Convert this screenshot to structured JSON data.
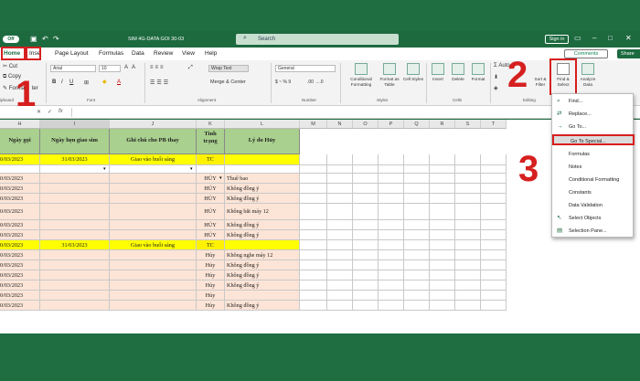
{
  "titlebar": {
    "autosave_toggle": "Off",
    "doc_name": "SIM 4G-DATA GOI 30-03",
    "search_placeholder": "Search",
    "signin": "Sign in"
  },
  "menu_tabs": [
    "Home",
    "Inse",
    "Page Layout",
    "Formulas",
    "Data",
    "Review",
    "View",
    "Help"
  ],
  "comments_label": "Comments",
  "share_label": "Share",
  "ribbon": {
    "clipboard": {
      "cut": "Cut",
      "copy": "Copy",
      "format": "Format",
      "painter_suffix": "ter",
      "label": "ipboard"
    },
    "font": {
      "name": "Arial",
      "size": "10",
      "label": "Font"
    },
    "alignment": {
      "wrap": "Wrap Text",
      "merge": "Merge & Center",
      "label": "Alignment"
    },
    "number": {
      "format": "General",
      "symbols": "$ ~ % 9",
      "decimals": ".00 →.0",
      "label": "Number"
    },
    "styles": {
      "conditional": "Conditional Formatting",
      "format_table": "Format as Table",
      "cell_styles": "Cell Styles",
      "label": "Styles"
    },
    "cells": {
      "insert": "Insert",
      "delete": "Delete",
      "format": "Format",
      "label": "Cells"
    },
    "editing": {
      "autosum": "Auto",
      "sort": "Sort & Filter",
      "find": "Find & Select",
      "analyze": "Analyze Data",
      "label": "Editing"
    }
  },
  "formula_bar": {
    "fx": "fx"
  },
  "columns": [
    "H",
    "I",
    "J",
    "K",
    "L",
    "M",
    "N",
    "O",
    "P",
    "Q",
    "R",
    "S",
    "T"
  ],
  "table_headers": {
    "h": "Ngày gọi",
    "i": "Ngày hẹn giao sim",
    "j": "Ghi chú cho PB thay",
    "k": "Tình trạng",
    "l": "Lý do Hủy"
  },
  "rows": [
    {
      "h": "0/03/2023",
      "i": "31/03/2023",
      "j": "Giao vào buổi sáng",
      "k": "TC",
      "l": "",
      "style": "yellow"
    },
    {
      "h": "",
      "i": "",
      "j": "",
      "k": "",
      "l": "",
      "style": "white"
    },
    {
      "h": "0/03/2023",
      "i": "",
      "j": "",
      "k": "HỦY",
      "l": "Thuê bao",
      "style": "pink"
    },
    {
      "h": "0/03/2023",
      "i": "",
      "j": "",
      "k": "HỦY",
      "l": "Không đồng ý",
      "style": "pink"
    },
    {
      "h": "0/03/2023",
      "i": "",
      "j": "",
      "k": "HỦY",
      "l": "Không đồng ý",
      "style": "pink"
    },
    {
      "h": "0/03/2023",
      "i": "",
      "j": "",
      "k": "HỦY",
      "l": "Không bắt máy 12",
      "style": "pink"
    },
    {
      "h": "0/03/2023",
      "i": "",
      "j": "",
      "k": "HỦY",
      "l": "Không đồng ý",
      "style": "pink"
    },
    {
      "h": "0/03/2023",
      "i": "",
      "j": "",
      "k": "HỦY",
      "l": "Không đồng ý",
      "style": "pink"
    },
    {
      "h": "0/03/2023",
      "i": "31/03/2023",
      "j": "Giao vào buổi sáng",
      "k": "TC",
      "l": "",
      "style": "yellow"
    },
    {
      "h": "0/03/2023",
      "i": "",
      "j": "",
      "k": "Hủy",
      "l": "Không nghe máy 12",
      "style": "pink"
    },
    {
      "h": "0/03/2023",
      "i": "",
      "j": "",
      "k": "Hủy",
      "l": "Không đồng ý",
      "style": "pink"
    },
    {
      "h": "0/03/2023",
      "i": "",
      "j": "",
      "k": "Hủy",
      "l": "Không đồng ý",
      "style": "pink"
    },
    {
      "h": "0/03/2023",
      "i": "",
      "j": "",
      "k": "Hủy",
      "l": "Không đồng ý",
      "style": "pink"
    },
    {
      "h": "0/03/2023",
      "i": "",
      "j": "",
      "k": "Hủy",
      "l": "",
      "style": "pink"
    },
    {
      "h": "0/03/2023",
      "i": "",
      "j": "",
      "k": "Hủy",
      "l": "Không đồng ý",
      "style": "pink"
    }
  ],
  "find_menu": [
    {
      "label": "Find...",
      "icon": "search-icon"
    },
    {
      "label": "Replace...",
      "icon": "replace-icon"
    },
    {
      "label": "Go To...",
      "icon": "arrow-right-icon"
    },
    {
      "label": "Go To Special...",
      "icon": "",
      "selected": true
    },
    {
      "label": "Formulas",
      "icon": ""
    },
    {
      "label": "Notes",
      "icon": ""
    },
    {
      "label": "Conditional Formatting",
      "icon": ""
    },
    {
      "label": "Constants",
      "icon": ""
    },
    {
      "label": "Data Validation",
      "icon": ""
    },
    {
      "label": "Select Objects",
      "icon": "cursor-icon"
    },
    {
      "label": "Selection Pane...",
      "icon": "pane-icon"
    }
  ],
  "step_numbers": [
    "1",
    "2",
    "3"
  ],
  "colors": {
    "excel_green": "#1d6a3f",
    "highlight_red": "#d61f1f",
    "header_green": "#a9d08e",
    "row_pink": "#fce4d6",
    "row_yellow": "#ffff00"
  }
}
